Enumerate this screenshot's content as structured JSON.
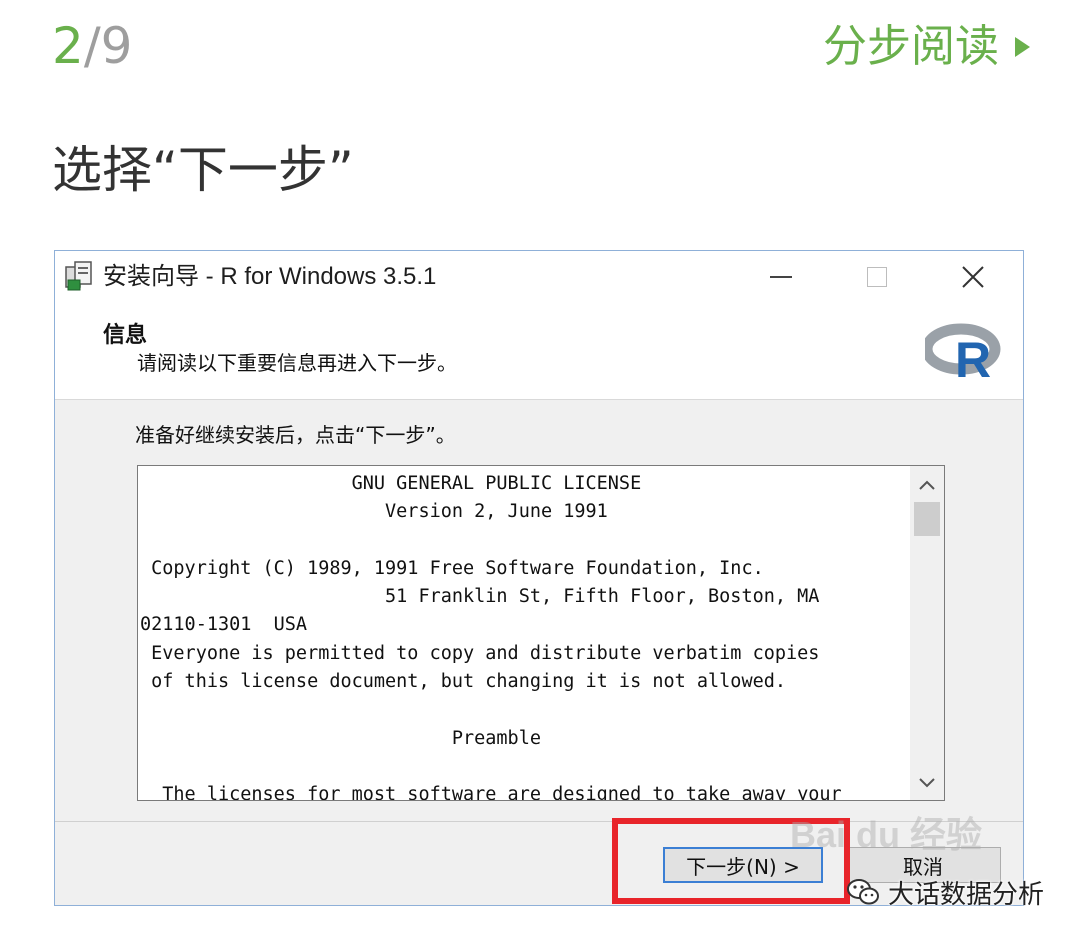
{
  "step": {
    "current": "2",
    "total": "/9",
    "read_label": "分步阅读"
  },
  "instruction": "选择“下一步”",
  "dialog": {
    "title": "安装向导 - R for Windows 3.5.1",
    "info_title": "信息",
    "info_sub": "请阅读以下重要信息再进入下一步。",
    "prompt": "准备好继续安装后，点击“下一步”。",
    "license_text": "                   GNU GENERAL PUBLIC LICENSE\n                      Version 2, June 1991\n\n Copyright (C) 1989, 1991 Free Software Foundation, Inc.\n                      51 Franklin St, Fifth Floor, Boston, MA\n02110-1301  USA\n Everyone is permitted to copy and distribute verbatim copies\n of this license document, but changing it is not allowed.\n\n                            Preamble\n\n  The licenses for most software are designed to take away your",
    "next_label": "下一步(N) >",
    "cancel_label": "取消"
  },
  "watermark": "Bai du 经验",
  "brand": "大话数据分析",
  "colors": {
    "accent_green": "#6ab04c",
    "highlight_red": "#e8242a",
    "focus_blue": "#3b7fd4"
  }
}
